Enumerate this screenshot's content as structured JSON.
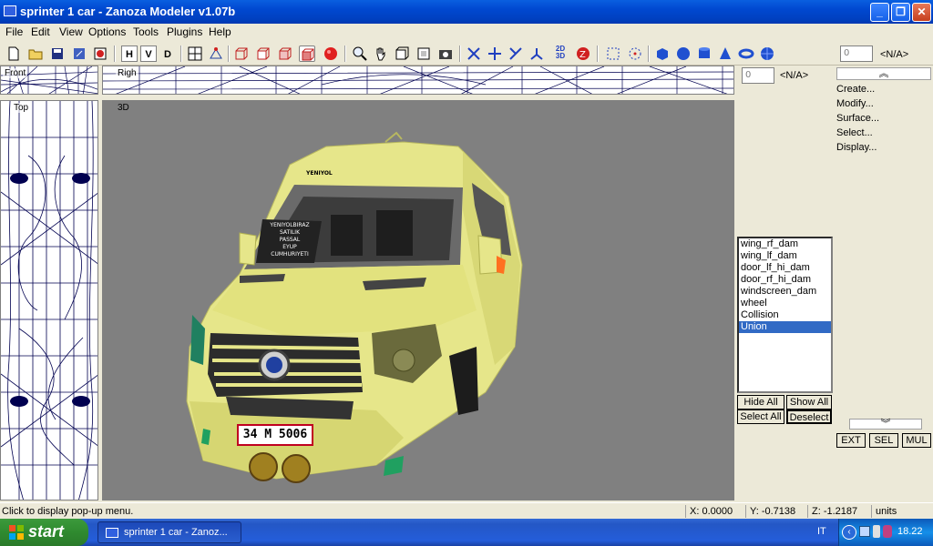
{
  "window": {
    "title": "sprinter 1 car - Zanoza Modeler v1.07b",
    "minimize": "_",
    "restore": "❐",
    "close": "✕"
  },
  "menu": [
    "File",
    "Edit",
    "View",
    "Options",
    "Tools",
    "Plugins",
    "Help"
  ],
  "toolbar": {
    "h": "H",
    "v": "V",
    "d": "D",
    "coord": "2D 3D"
  },
  "viewports": {
    "front": "Front",
    "right": "Righ",
    "top": "Top",
    "threed": "3D"
  },
  "right_panel": {
    "spin_value": "0",
    "spin_label": "<N/A>",
    "spin2_value": "0",
    "spin2_label": "<N/A>",
    "collapse_icon": "up-chevron",
    "commands": [
      "Create...",
      "Modify...",
      "Surface...",
      "Select...",
      "Display..."
    ],
    "objects": [
      "wing_rf_dam",
      "wing_lf_dam",
      "door_lf_hi_dam",
      "door_rf_hi_dam",
      "windscreen_dam",
      "wheel",
      "Collision",
      "Union"
    ],
    "selected_object": "Union",
    "hide_all": "Hide All",
    "show_all": "Show All",
    "select_all": "Select All",
    "deselect": "Deselect",
    "ext": "EXT",
    "sel": "SEL",
    "mul": "MUL"
  },
  "model": {
    "plate": "34 M 5006",
    "sign_text": [
      "YENIYOLBIRAZ",
      "SATILIK",
      "PASSAL",
      "EYUP",
      "CUMHURIYETI"
    ],
    "windshield_text": "YENIYOL"
  },
  "status": {
    "hint": "Click to display pop-up menu.",
    "x": "X: 0.0000",
    "y": "Y: -0.7138",
    "z": "Z: -1.2187",
    "units": "units"
  },
  "taskbar": {
    "start": "start",
    "task": "sprinter 1 car - Zanoz...",
    "lang": "IT",
    "time": "18.22"
  },
  "colors": {
    "viewport_bg": "#808080",
    "body": "#e6e68a",
    "wire": "#000050",
    "selection": "#316ac5"
  }
}
